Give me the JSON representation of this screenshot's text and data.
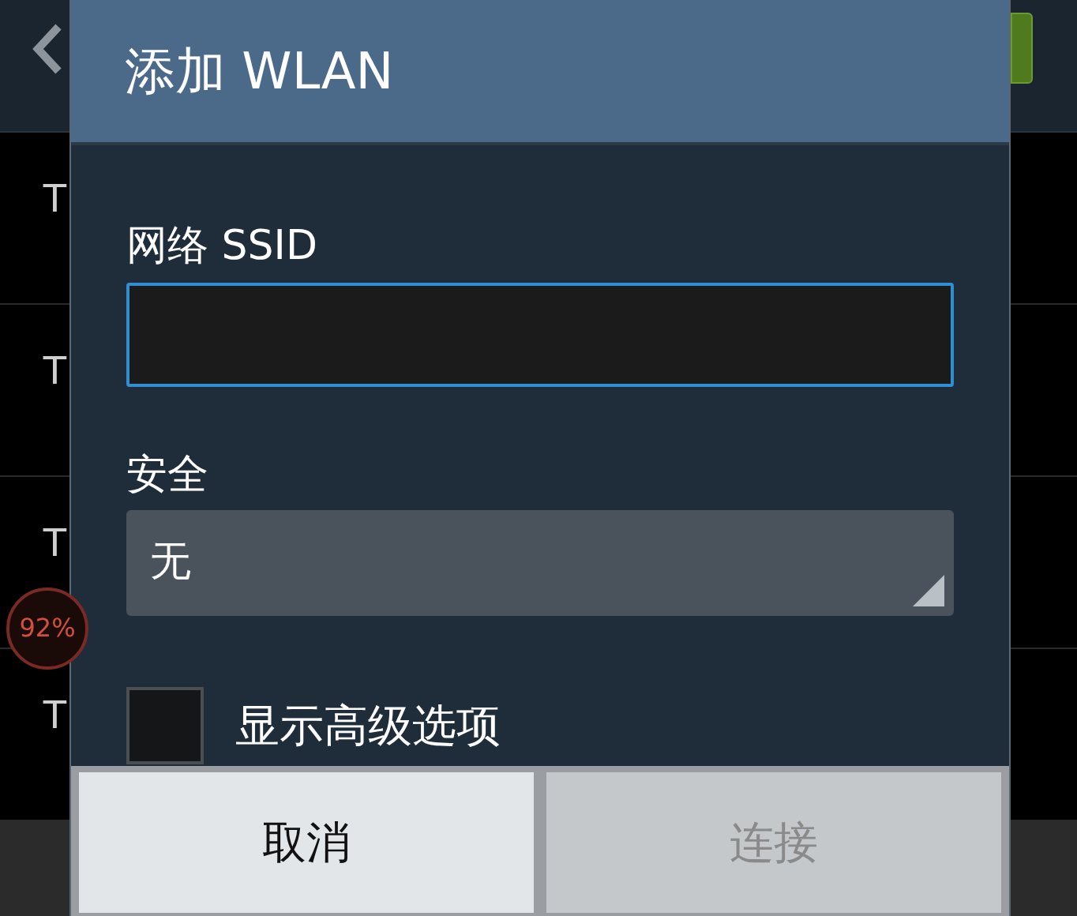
{
  "background": {
    "list_items": [
      {
        "title": "T"
      },
      {
        "title": "T"
      },
      {
        "title": "T"
      },
      {
        "title": "T"
      }
    ],
    "badge": "92%"
  },
  "dialog": {
    "title": "添加 WLAN",
    "ssid": {
      "label": "网络 SSID"
    },
    "security": {
      "label": "安全",
      "value": "无"
    },
    "advanced": {
      "label": "显示高级选项",
      "checked": false
    },
    "buttons": [
      {
        "label": "取消",
        "disabled": false
      },
      {
        "label": "连接",
        "disabled": true
      }
    ]
  }
}
